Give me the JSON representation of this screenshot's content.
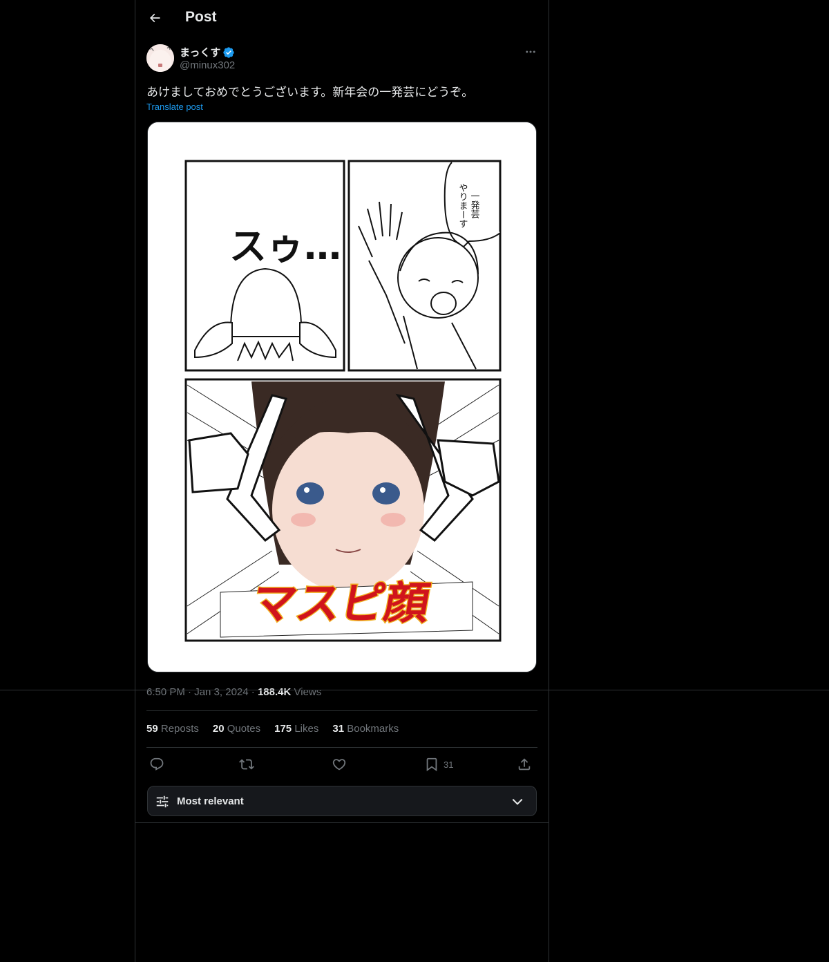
{
  "header": {
    "title": "Post",
    "back_icon": "arrow-left-icon"
  },
  "author": {
    "name": "まっくす",
    "handle": "@minux302",
    "verified_icon": "verified-badge-icon",
    "verified_color": "#1d9bf0"
  },
  "post": {
    "text": "あけましておめでとうございます。新年会の一発芸にどうぞ。",
    "translate_label": "Translate post",
    "media": {
      "speech_bubble_line1": "一発芸",
      "speech_bubble_line2": "やりまーす",
      "sfx_text": "スゥ…",
      "banner_text": "マスピ顔"
    },
    "time": "6:50 PM",
    "date": "Jan 3, 2024",
    "views_count": "188.4K",
    "views_label": "Views"
  },
  "stats": [
    {
      "count": "59",
      "label": "Reposts"
    },
    {
      "count": "20",
      "label": "Quotes"
    },
    {
      "count": "175",
      "label": "Likes"
    },
    {
      "count": "31",
      "label": "Bookmarks"
    }
  ],
  "actions": {
    "reply_icon": "reply-icon",
    "repost_icon": "repost-icon",
    "like_icon": "heart-icon",
    "bookmark_icon": "bookmark-icon",
    "bookmark_count": "31",
    "share_icon": "share-icon"
  },
  "sort": {
    "label": "Most relevant",
    "icon": "sliders-icon",
    "chevron": "chevron-down-icon"
  },
  "colors": {
    "background": "#000000",
    "text": "#e7e9ea",
    "muted": "#71767b",
    "accent": "#1d9bf0",
    "border": "#2f3336"
  }
}
